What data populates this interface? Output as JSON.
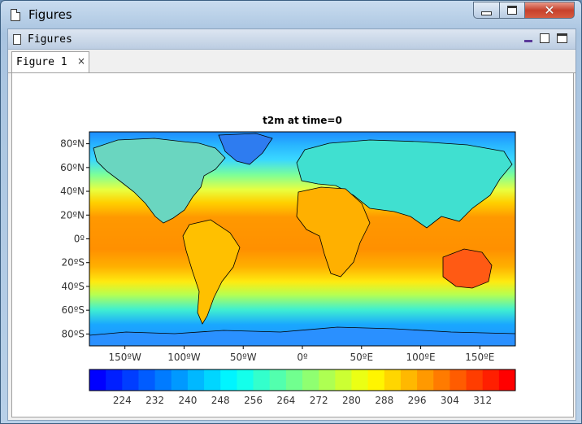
{
  "window": {
    "title": "Figures",
    "min_label": "",
    "max_label": "",
    "close_label": "✕"
  },
  "panel": {
    "title": "Figures"
  },
  "tabs": [
    {
      "label": "Figure 1",
      "close": "×"
    }
  ],
  "colors": {
    "titlebar": "#b8d0e8",
    "close_button": "#c7412c"
  },
  "chart_data": {
    "type": "heatmap",
    "title": "t2m at time=0",
    "x_ticks": [
      "150ºW",
      "100ºW",
      "50ºW",
      "0º",
      "50ºE",
      "100ºE",
      "150ºE"
    ],
    "x_tick_values": [
      -150,
      -100,
      -50,
      0,
      50,
      100,
      150
    ],
    "y_ticks": [
      "80ºN",
      "60ºN",
      "40ºN",
      "20ºN",
      "0º",
      "20ºS",
      "40ºS",
      "60ºS",
      "80ºS"
    ],
    "y_tick_values": [
      80,
      60,
      40,
      20,
      0,
      -20,
      -40,
      -60,
      -80
    ],
    "xlim": [
      -180,
      180
    ],
    "ylim": [
      -90,
      90
    ],
    "colorbar_labels": [
      "224",
      "232",
      "240",
      "248",
      "256",
      "264",
      "272",
      "280",
      "288",
      "296",
      "304",
      "312"
    ],
    "colorbar_range": [
      216,
      320
    ],
    "colorbar_levels": 26,
    "colormap": [
      "#0000ff",
      "#0080ff",
      "#00ffff",
      "#80ff80",
      "#ffff00",
      "#ff8000",
      "#ff0000"
    ]
  }
}
